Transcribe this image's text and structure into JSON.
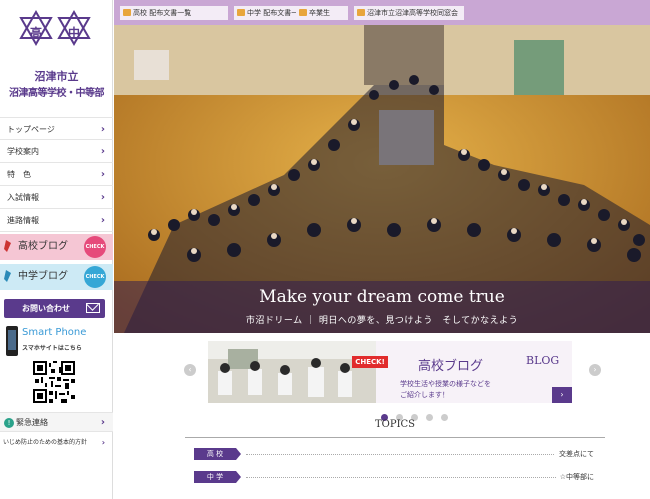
{
  "logo": {
    "emblem_left": "高",
    "emblem_right": "中",
    "line1": "沼津市立",
    "line2": "沼津高等学校・中等部"
  },
  "nav": [
    {
      "label": "トップページ"
    },
    {
      "label": "学校案内"
    },
    {
      "label": "特　色"
    },
    {
      "label": "入試情報"
    },
    {
      "label": "進路情報"
    }
  ],
  "blogs": {
    "high": {
      "label": "高校ブログ",
      "badge": "CHECK"
    },
    "junior": {
      "label": "中学ブログ",
      "badge": "CHECK"
    }
  },
  "contact": {
    "label": "お問い合わせ"
  },
  "smartphone": {
    "title": "Smart Phone",
    "subtitle": "スマホサイトはこちら"
  },
  "emergency": {
    "label": "緊急連絡"
  },
  "bullying": {
    "label": "いじめ防止のための基本的方針"
  },
  "topbar": [
    {
      "label": "高校 配布文書一覧"
    },
    {
      "label": "中学 配布文書一覧"
    },
    {
      "label": "卒業生"
    },
    {
      "label": "沼津市立沼津高等学校同窓会"
    }
  ],
  "hero": {
    "title": "Make your dream come true",
    "subtitle": "市沼ドリーム ｜ 明日への夢を、見つけよう　そしてかなえよう"
  },
  "banner": {
    "badge": "CHECK!",
    "title": "高校ブログ",
    "text_line1": "学校生活や授業の様子などを",
    "text_line2": "ご紹介します！",
    "blog_word": "BLOG"
  },
  "topics": {
    "heading": "TOPICS",
    "rows": [
      {
        "tag": "高 校",
        "text": "交差点にて"
      },
      {
        "tag": "中 学",
        "text": "☆中等部に"
      }
    ]
  },
  "colors": {
    "brand_purple": "#5a3a8c",
    "topbar": "#c9a7d4",
    "hs_blog": "#f5c6d4",
    "jh_blog": "#cdeaf5"
  }
}
